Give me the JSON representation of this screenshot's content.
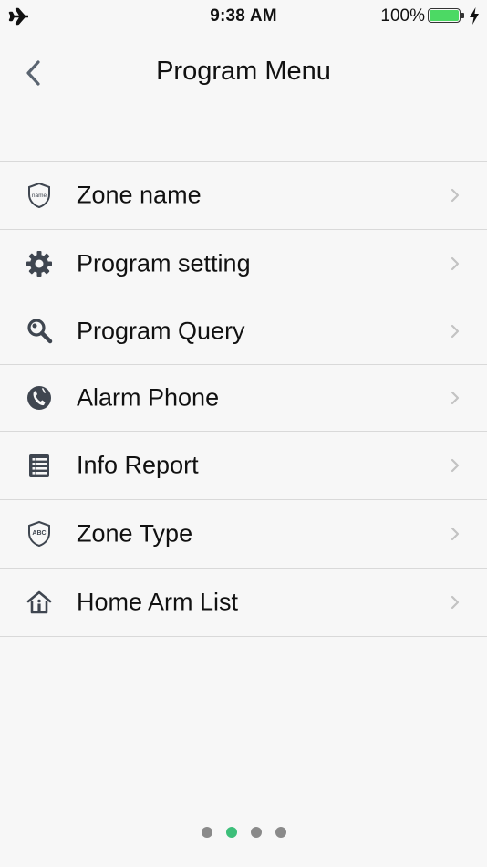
{
  "status_bar": {
    "time": "9:38 AM",
    "battery_percent": "100%",
    "battery_level": 1.0,
    "battery_color": "#4cd964",
    "airplane_icon": "airplane-icon",
    "charging_icon": "lightning-icon"
  },
  "nav": {
    "title": "Program Menu",
    "back_icon": "chevron-left-icon"
  },
  "menu": {
    "items": [
      {
        "label": "Zone name",
        "icon": "shield-name-icon"
      },
      {
        "label": "Program setting",
        "icon": "gear-icon"
      },
      {
        "label": "Program Query",
        "icon": "search-icon"
      },
      {
        "label": "Alarm Phone",
        "icon": "phone-circle-icon"
      },
      {
        "label": "Info Report",
        "icon": "list-document-icon"
      },
      {
        "label": "Zone Type",
        "icon": "shield-abc-icon"
      },
      {
        "label": "Home Arm List",
        "icon": "home-info-icon"
      }
    ],
    "shield_name_text": "name",
    "shield_abc_text": "ABC"
  },
  "pager": {
    "count": 4,
    "active_index": 1,
    "active_color": "#3dbf7a"
  }
}
